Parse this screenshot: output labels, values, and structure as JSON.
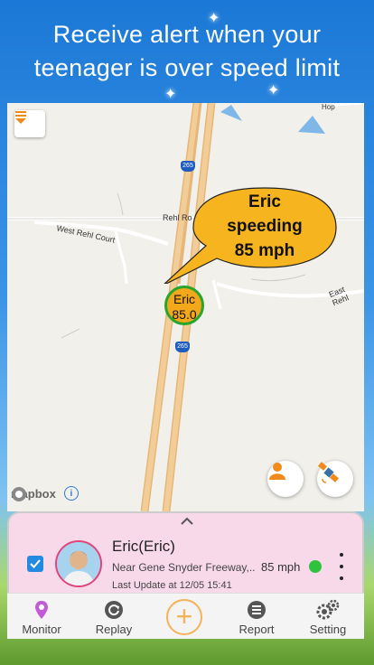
{
  "headline": {
    "line1": "Receive alert when your",
    "line2": "teenager is over speed limit"
  },
  "map": {
    "roads": {
      "rehl_road": "Rehl Ro",
      "west_rehl_court": "West Rehl Court",
      "east_rehl": "East Rehl",
      "shield_top": "265",
      "shield_bottom": "265",
      "corner_label": "Hop"
    },
    "speech_bubble": {
      "line1": "Eric",
      "line2": "speeding",
      "line3": "85 mph"
    },
    "marker": {
      "name": "Eric",
      "speed": "85.0"
    },
    "attribution": "mapbox",
    "info_icon": "i"
  },
  "device_card": {
    "checked": true,
    "name": "Eric(Eric)",
    "address": "Near Gene Snyder Freeway,..",
    "last_update": "Last Update at 12/05 15:41",
    "speed": "85 mph",
    "status_color": "#2fc33d"
  },
  "tabbar": {
    "tabs": [
      {
        "label": "Monitor",
        "icon": "location-pin-icon"
      },
      {
        "label": "Replay",
        "icon": "replay-icon"
      },
      {
        "label": "",
        "icon": "plus-icon"
      },
      {
        "label": "Report",
        "icon": "report-list-icon"
      },
      {
        "label": "Setting",
        "icon": "gears-icon"
      }
    ]
  },
  "colors": {
    "marker_fill": "#f3a81b",
    "marker_ring": "#27a52c",
    "card_bg": "#f8d9ea",
    "accent_orange": "#f4b35a",
    "monitor_icon": "#c45bd6"
  }
}
